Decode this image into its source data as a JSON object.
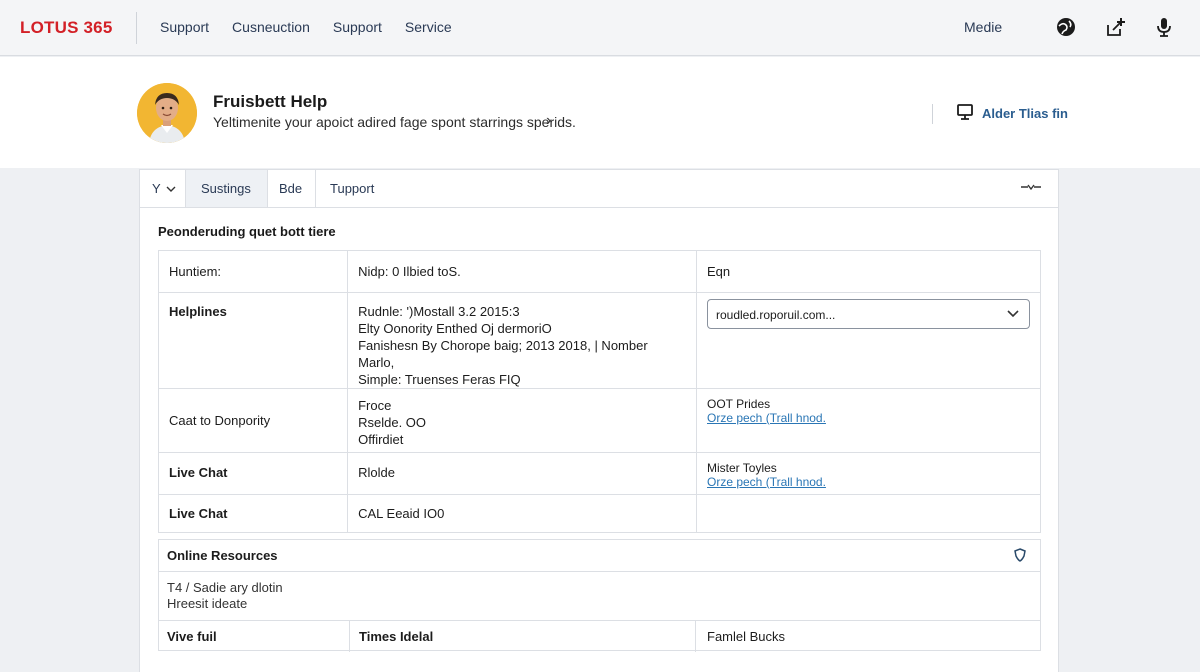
{
  "header": {
    "logo": "LOTUS 365",
    "nav": [
      "Support",
      "Cusneuction",
      "Support",
      "Service"
    ],
    "right_link": "Medie",
    "icons": [
      "globe-icon",
      "share-icon",
      "microphone-icon"
    ],
    "brand_color": "#d32027"
  },
  "profile": {
    "title": "Fruisbett Help",
    "subtitle": "Yeltimenite your apoict adired fage spont starrings sperids.",
    "chevron": "›",
    "right_label": "Alder Tlias fin",
    "right_icon": "monitor-icon"
  },
  "tabs": [
    {
      "label": "Y",
      "active": false
    },
    {
      "label": "Sustings",
      "active": true
    },
    {
      "label": "Bde",
      "active": false
    },
    {
      "label": "Tupport",
      "active": false
    }
  ],
  "section_title": "Peonderuding quet bott tiere",
  "table": {
    "rows": [
      {
        "label": "Huntiem:",
        "label_bold": false,
        "middle": [
          "Nidp: 0 Ilbied toS."
        ],
        "right": {
          "type": "text",
          "lines": [
            "Eqn"
          ]
        }
      },
      {
        "label": "Helplines",
        "label_bold": true,
        "middle": [
          "Rudnle: ')Mostall 3.2 2015:3",
          "Elty Oonority Enthed Oj dermoriO",
          "Fanishesn By Chorope baig; 2013 2018, | Nomber Marlo,",
          "Simple: Truenses Feras FIQ"
        ],
        "right": {
          "type": "select",
          "value": "roudled.roporuil.com..."
        }
      },
      {
        "label": "Caat to Donpority",
        "label_bold": false,
        "middle": [
          "Froce",
          "Rselde. OO",
          "Offirdiet"
        ],
        "right": {
          "type": "text_link",
          "text": "OOT Prides",
          "link": "Orze pech (Trall hnod."
        }
      },
      {
        "label": "Live Chat",
        "label_bold": true,
        "middle": [
          "Rlolde"
        ],
        "right": {
          "type": "text_link",
          "text": "Mister Toyles",
          "link": "Orze pech (Trall hnod."
        }
      },
      {
        "label": "Live Chat",
        "label_bold": true,
        "middle": [
          "CAL Eeaid IO0"
        ],
        "right": {
          "type": "empty"
        }
      }
    ]
  },
  "resources": {
    "title": "Online Resources",
    "icon": "shield-icon",
    "lines": [
      "T4 / Sadie ary dlotin",
      "Hreesit ideate"
    ],
    "row": [
      "Vive fuil",
      "Times Idelal",
      "Famlel Bucks"
    ]
  }
}
